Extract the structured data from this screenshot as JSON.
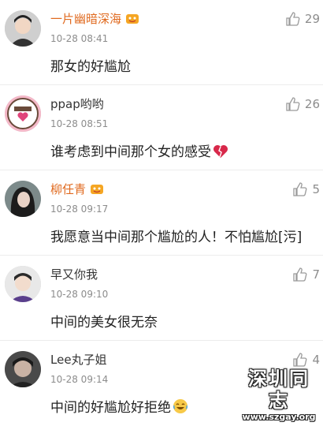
{
  "comments": [
    {
      "name": "一片幽暗深海",
      "vip": true,
      "time": "10-28 08:41",
      "text": "那女的好尴尬",
      "likes": "29",
      "avatar": "male-avatar"
    },
    {
      "name": "ppap哟哟",
      "vip": false,
      "time": "10-28 08:51",
      "text": "谁考虑到中间那个女的感受",
      "likes": "26",
      "avatar": "kimi-avatar",
      "trailing_icon": "broken-heart-icon"
    },
    {
      "name": "柳任青",
      "vip": true,
      "time": "10-28 09:17",
      "text": "我愿意当中间那个尴尬的人！不怕尴尬[污]",
      "likes": "5",
      "avatar": "female-avatar"
    },
    {
      "name": "早又你我",
      "vip": false,
      "time": "10-28 09:10",
      "text": "中间的美女很无奈",
      "likes": "7",
      "avatar": "boy-avatar"
    },
    {
      "name": "Lee丸子姐",
      "vip": false,
      "time": "10-28 09:14",
      "text": "中间的好尴尬好拒绝",
      "likes": "4",
      "avatar": "dark-avatar",
      "trailing_icon": "laughing-emoji-icon"
    }
  ],
  "watermark": {
    "title": "深圳同志",
    "url": "www.szgay.org"
  },
  "colors": {
    "vip_name": "#e06a1f",
    "time": "#8c8c8c",
    "divider": "#ececec"
  }
}
